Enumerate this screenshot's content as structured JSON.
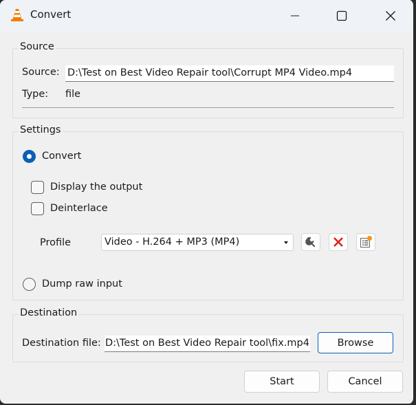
{
  "window": {
    "title": "Convert",
    "app_icon": "vlc-cone-icon",
    "controls": {
      "minimize": "minimize-icon",
      "maximize": "maximize-icon",
      "close": "close-icon"
    }
  },
  "source": {
    "group_label": "Source",
    "source_label": "Source:",
    "source_value": "D:\\Test on Best Video Repair tool\\Corrupt MP4 Video.mp4",
    "type_label": "Type:",
    "type_value": "file"
  },
  "settings": {
    "group_label": "Settings",
    "convert_label": "Convert",
    "convert_selected": true,
    "display_output_label": "Display the output",
    "display_output_checked": false,
    "deinterlace_label": "Deinterlace",
    "deinterlace_checked": false,
    "profile_label": "Profile",
    "profile_selected": "Video - H.264 + MP3 (MP4)",
    "profile_buttons": [
      "edit-profile-wrench-icon",
      "delete-profile-x-icon",
      "new-profile-list-icon"
    ],
    "dump_raw_label": "Dump raw input",
    "dump_raw_selected": false
  },
  "destination": {
    "group_label": "Destination",
    "file_label": "Destination file:",
    "file_value": "D:\\Test on Best Video Repair tool\\fix.mp4",
    "browse_label": "Browse"
  },
  "footer": {
    "start_label": "Start",
    "cancel_label": "Cancel"
  },
  "colors": {
    "accent": "#0a5fb5",
    "delete_red": "#e02020",
    "badge_orange": "#f7941d"
  }
}
